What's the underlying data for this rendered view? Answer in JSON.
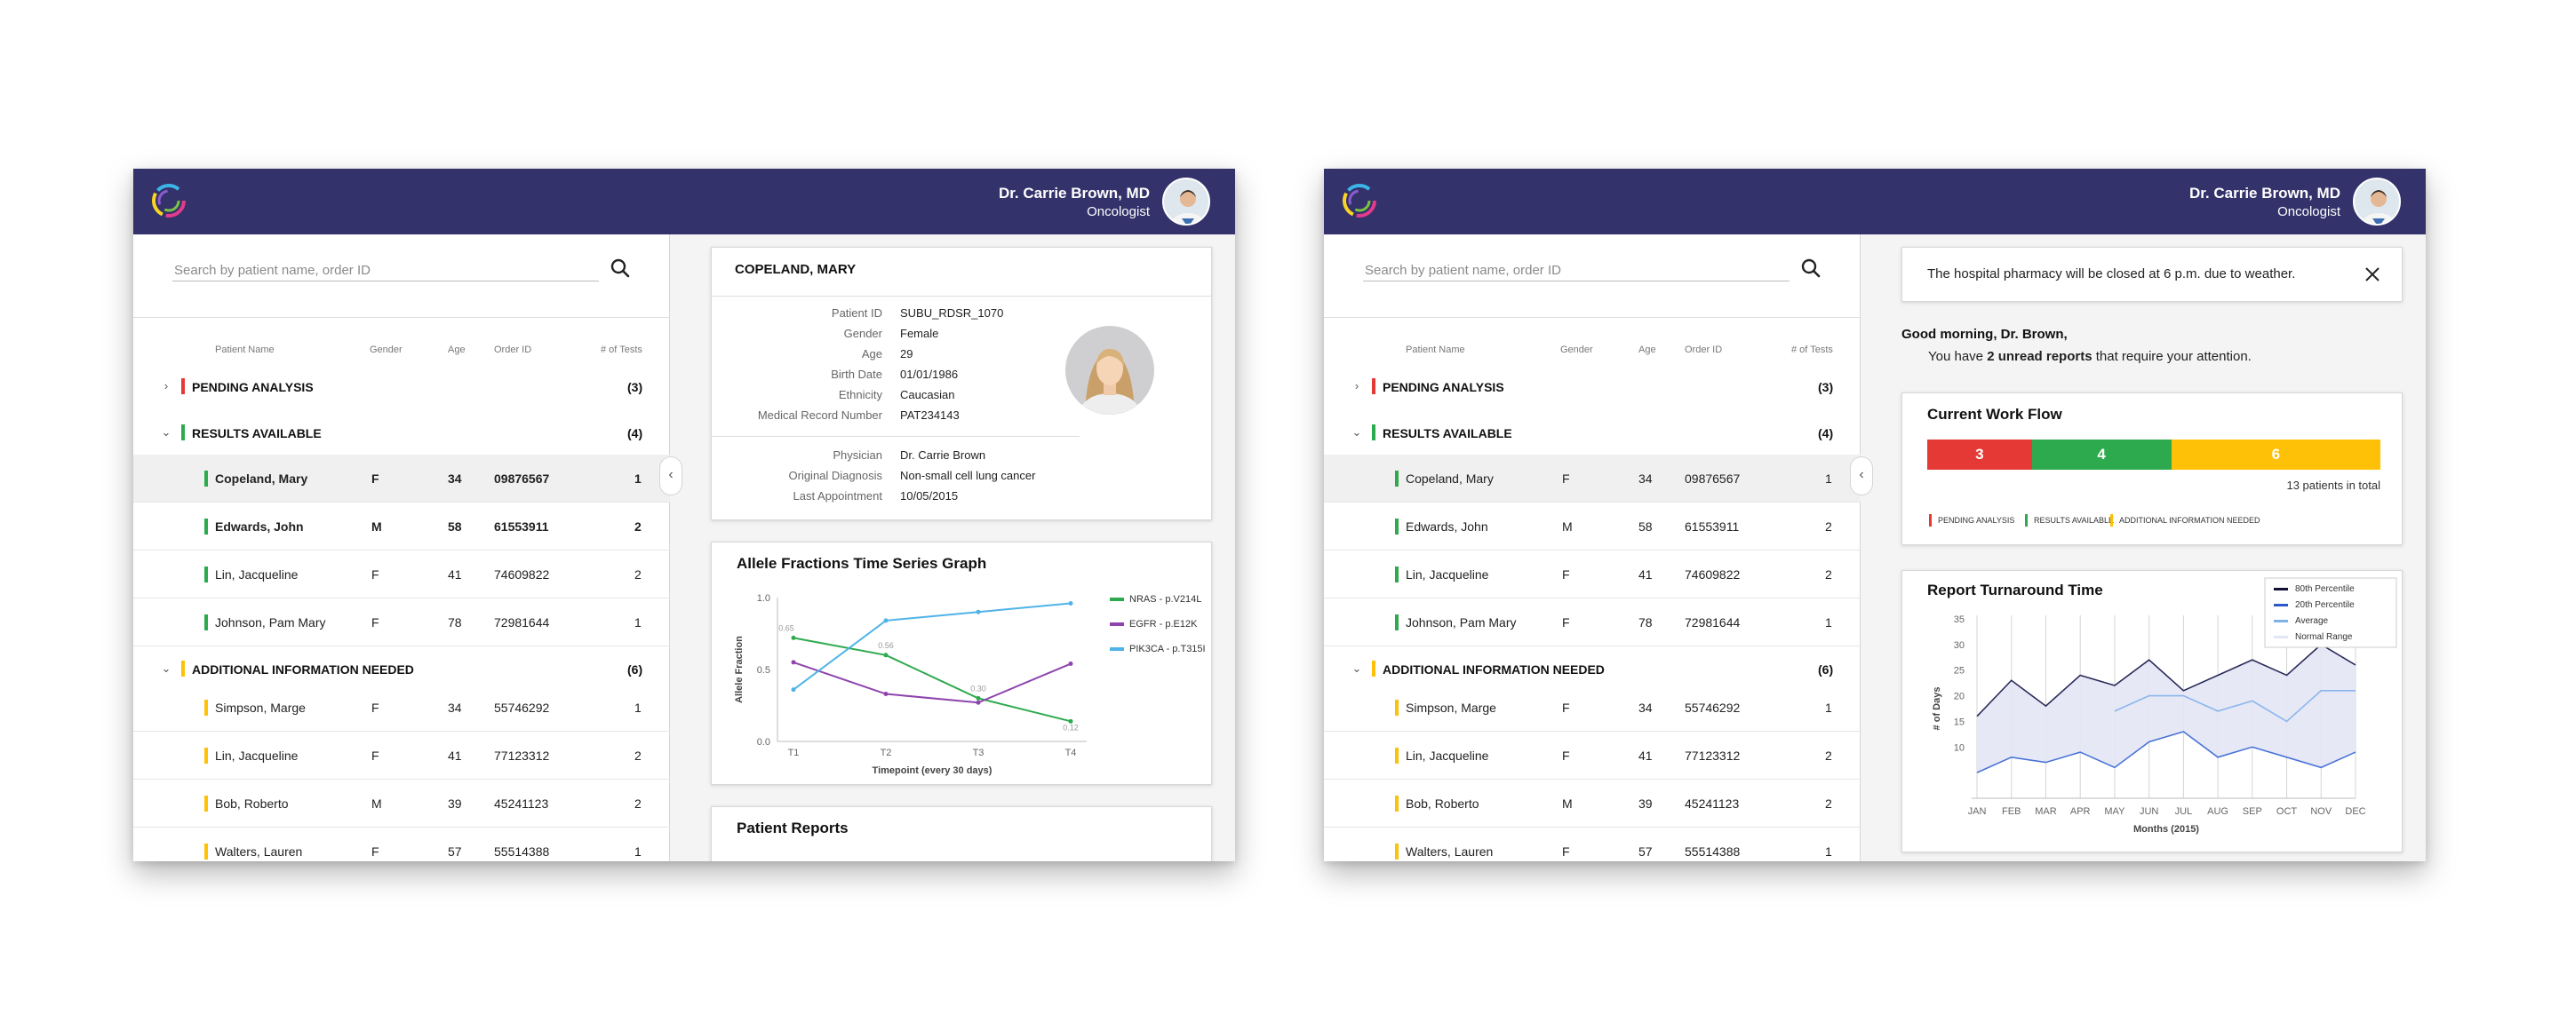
{
  "header": {
    "doctor_name": "Dr. Carrie Brown, MD",
    "doctor_role": "Oncologist"
  },
  "search": {
    "placeholder": "Search by patient name, order ID"
  },
  "table": {
    "columns": [
      "Patient Name",
      "Gender",
      "Age",
      "Order ID",
      "# of Tests"
    ],
    "groups": [
      {
        "label": "PENDING ANALYSIS",
        "count": "(3)",
        "color": "#e53935"
      },
      {
        "label": "RESULTS AVAILABLE",
        "count": "(4)",
        "color": "#2eaa4e"
      },
      {
        "label": "ADDITIONAL INFORMATION NEEDED",
        "count": "(6)",
        "color": "#ffc107"
      }
    ],
    "results_rows": [
      {
        "name": "Copeland, Mary",
        "gender": "F",
        "age": "34",
        "order": "09876567",
        "tests": "1"
      },
      {
        "name": "Edwards, John",
        "gender": "M",
        "age": "58",
        "order": "61553911",
        "tests": "2"
      },
      {
        "name": "Lin, Jacqueline",
        "gender": "F",
        "age": "41",
        "order": "74609822",
        "tests": "2"
      },
      {
        "name": "Johnson, Pam Mary",
        "gender": "F",
        "age": "78",
        "order": "72981644",
        "tests": "1"
      }
    ],
    "additional_rows": [
      {
        "name": "Simpson, Marge",
        "gender": "F",
        "age": "34",
        "order": "55746292",
        "tests": "1"
      },
      {
        "name": "Lin, Jacqueline",
        "gender": "F",
        "age": "41",
        "order": "77123312",
        "tests": "2"
      },
      {
        "name": "Bob, Roberto",
        "gender": "M",
        "age": "39",
        "order": "45241123",
        "tests": "2"
      },
      {
        "name": "Walters, Lauren",
        "gender": "F",
        "age": "57",
        "order": "55514388",
        "tests": "1"
      }
    ]
  },
  "patient": {
    "title": "COPELAND, MARY",
    "fields": [
      {
        "label": "Patient ID",
        "value": "SUBU_RDSR_1070"
      },
      {
        "label": "Gender",
        "value": "Female"
      },
      {
        "label": "Age",
        "value": "29"
      },
      {
        "label": "Birth Date",
        "value": "01/01/1986"
      },
      {
        "label": "Ethnicity",
        "value": "Caucasian"
      },
      {
        "label": "Medical Record Number",
        "value": "PAT234143"
      }
    ],
    "fields2": [
      {
        "label": "Physician",
        "value": "Dr. Carrie Brown"
      },
      {
        "label": "Original Diagnosis",
        "value": "Non-small cell lung cancer"
      },
      {
        "label": "Last Appointment",
        "value": "10/05/2015"
      }
    ]
  },
  "reports": {
    "title": "Patient Reports"
  },
  "notice": {
    "text": "The hospital pharmacy will be closed at 6 p.m. due to weather."
  },
  "greeting": {
    "title": "Good morning, Dr. Brown,",
    "line_before": "You have ",
    "line_bold": "2 unread reports",
    "line_after": " that require your attention."
  },
  "workflow": {
    "title": "Current Work Flow",
    "segments": [
      {
        "label": "PENDING ANALYSIS",
        "value": 3,
        "text": "3",
        "color": "#e53935"
      },
      {
        "label": "RESULTS AVAILABLE",
        "value": 4,
        "text": "4",
        "color": "#2eaa4e"
      },
      {
        "label": "ADDITIONAL INFORMATION NEEDED",
        "value": 6,
        "text": "6",
        "color": "#ffc107"
      }
    ],
    "total_text": "13 patients in total"
  },
  "chart_data": [
    {
      "type": "line",
      "title": "Allele Fractions Time Series Graph",
      "xlabel": "Timepoint (every 30 days)",
      "ylabel": "Allele Fraction",
      "categories": [
        "T1",
        "T2",
        "T3",
        "T4"
      ],
      "ylim": [
        0,
        1.0
      ],
      "yticks": [
        "0.0",
        "0.5",
        "1.0"
      ],
      "series": [
        {
          "name": "NRAS - p.V214L",
          "color": "#2eaa4e",
          "values": [
            0.72,
            0.6,
            0.3,
            0.14
          ]
        },
        {
          "name": "EGFR - p.E12K",
          "color": "#8e44ad",
          "values": [
            0.55,
            0.33,
            0.27,
            0.54
          ]
        },
        {
          "name": "PIK3CA - p.T315I",
          "color": "#4fb3e8",
          "values": [
            0.36,
            0.84,
            0.9,
            0.96
          ]
        }
      ],
      "annotations": [
        "0.65",
        "0.56",
        "0.30",
        "0.12"
      ]
    },
    {
      "type": "area",
      "title": "Report Turnaround Time",
      "xlabel": "Months (2015)",
      "ylabel": "# of Days",
      "categories": [
        "JAN",
        "FEB",
        "MAR",
        "APR",
        "MAY",
        "JUN",
        "JUL",
        "AUG",
        "SEP",
        "OCT",
        "NOV",
        "DEC"
      ],
      "ylim": [
        0,
        35
      ],
      "yticks": [
        10,
        15,
        20,
        25,
        30,
        35
      ],
      "legend": [
        "80th Percentile",
        "20th Percentile",
        "Average",
        "Normal Range"
      ],
      "series": [
        {
          "name": "80th Percentile",
          "color": "#2a2a5a",
          "values": [
            16,
            23,
            18,
            24,
            22,
            27,
            21,
            24,
            27,
            24,
            30,
            26
          ]
        },
        {
          "name": "20th Percentile",
          "color": "#4a73d8",
          "values": [
            5,
            8,
            7,
            9,
            6,
            11,
            13,
            8,
            10,
            8,
            6,
            9
          ]
        },
        {
          "name": "Average",
          "color": "#8ab5ec",
          "values": [
            null,
            null,
            null,
            null,
            17,
            20,
            20,
            17,
            19,
            15,
            21,
            21
          ]
        }
      ]
    }
  ]
}
